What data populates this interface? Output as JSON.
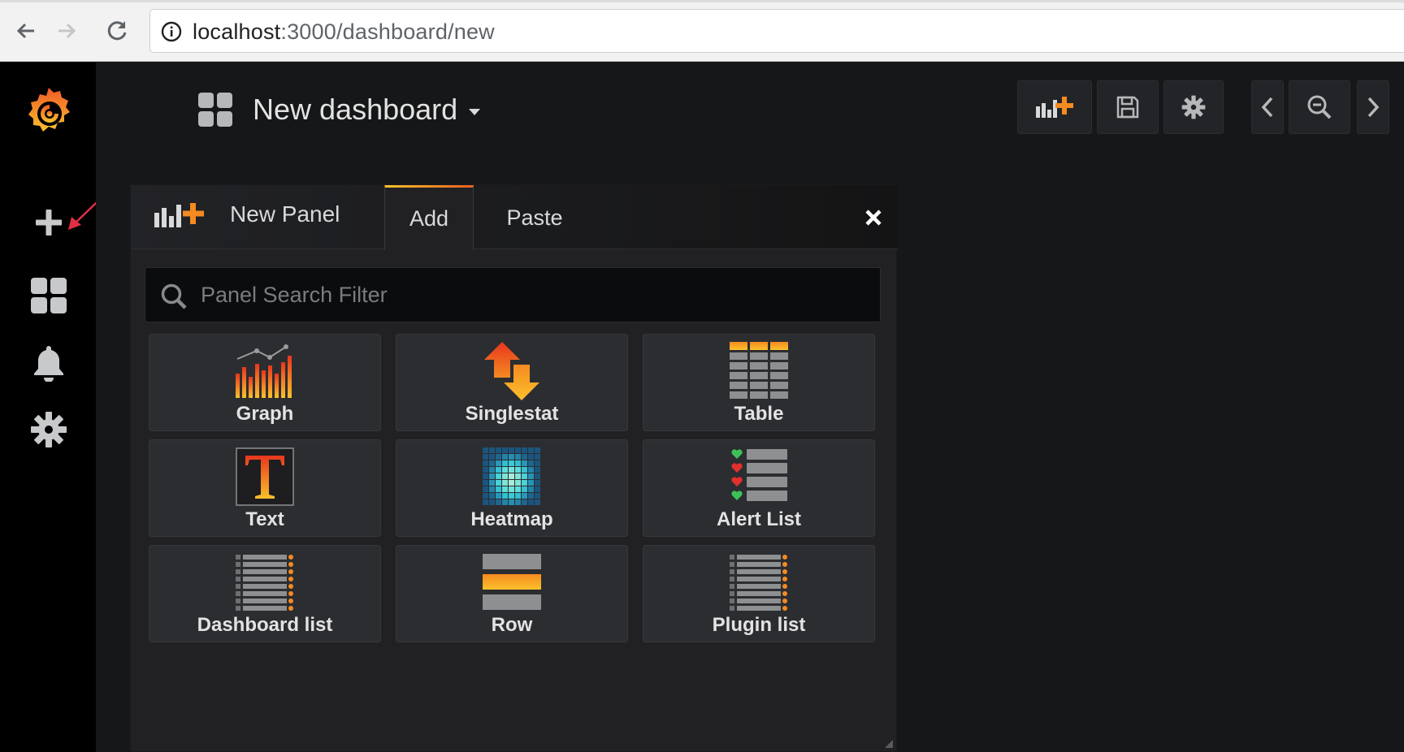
{
  "browser": {
    "url_host": "localhost",
    "url_path": ":3000/dashboard/new"
  },
  "dashboard": {
    "title": "New dashboard"
  },
  "panel": {
    "header_title": "New Panel",
    "tabs": [
      "Add",
      "Paste"
    ],
    "active_tab": "Add",
    "search_placeholder": "Panel Search Filter",
    "items": [
      {
        "label": "Graph",
        "icon": "graph-icon"
      },
      {
        "label": "Singlestat",
        "icon": "singlestat-icon"
      },
      {
        "label": "Table",
        "icon": "table-icon"
      },
      {
        "label": "Text",
        "icon": "text-icon"
      },
      {
        "label": "Heatmap",
        "icon": "heatmap-icon"
      },
      {
        "label": "Alert List",
        "icon": "alert-list-icon"
      },
      {
        "label": "Dashboard list",
        "icon": "dashboard-list-icon"
      },
      {
        "label": "Row",
        "icon": "row-icon"
      },
      {
        "label": "Plugin list",
        "icon": "plugin-list-icon"
      }
    ]
  },
  "colors": {
    "accent_orange": "#f58a21",
    "accent_yellow": "#fbc12b",
    "annotation_arrow": "#e02f44",
    "sidemenu_bg": "#000000",
    "main_bg": "#161719"
  }
}
